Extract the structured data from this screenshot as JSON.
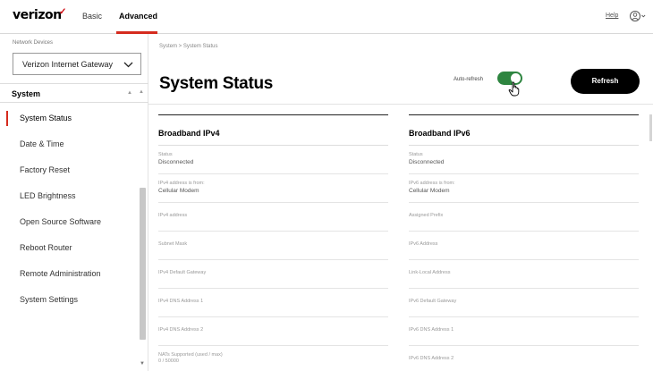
{
  "header": {
    "logo_text": "verizon",
    "logo_mark": "✓",
    "nav_basic": "Basic",
    "nav_advanced": "Advanced",
    "help": "Help",
    "user_icon": "user-circle-icon",
    "accent_color": "#d52b1e"
  },
  "sidebar": {
    "caption": "Network Devices",
    "device_select": "Verizon Internet Gateway",
    "section_title": "System",
    "items": [
      {
        "label": "System Status",
        "active": true
      },
      {
        "label": "Date & Time"
      },
      {
        "label": "Factory Reset"
      },
      {
        "label": "LED Brightness"
      },
      {
        "label": "Open Source Software"
      },
      {
        "label": "Reboot Router"
      },
      {
        "label": "Remote Administration"
      },
      {
        "label": "System Settings"
      }
    ]
  },
  "main": {
    "breadcrumb": "System  >  System Status",
    "title": "System Status",
    "auto_refresh_label": "Auto-refresh",
    "auto_refresh_on": true,
    "toggle_color": "#2e8540",
    "refresh_button": "Refresh",
    "ipv4": {
      "heading": "Broadband IPv4",
      "fields": [
        {
          "label": "Status",
          "value": "Disconnected"
        },
        {
          "label": "IPv4 address is from:",
          "value": "Cellular Modem"
        },
        {
          "label": "IPv4 address",
          "value": ""
        },
        {
          "label": "Subnet Mask",
          "value": ""
        },
        {
          "label": "IPv4 Default Gateway",
          "value": ""
        },
        {
          "label": "IPv4 DNS Address 1",
          "value": ""
        },
        {
          "label": "IPv4 DNS Address 2",
          "value": ""
        },
        {
          "label": "NATs Supported (used / max)",
          "value": "0 / 50000"
        }
      ]
    },
    "ipv6": {
      "heading": "Broadband IPv6",
      "fields": [
        {
          "label": "Status",
          "value": "Disconnected"
        },
        {
          "label": "IPv6 address is from:",
          "value": "Cellular Modem"
        },
        {
          "label": "Assigned Prefix",
          "value": ""
        },
        {
          "label": "IPv6 Address",
          "value": ""
        },
        {
          "label": "Link-Local Address",
          "value": ""
        },
        {
          "label": "IPv6 Default Gateway",
          "value": ""
        },
        {
          "label": "IPv6 DNS Address 1",
          "value": ""
        },
        {
          "label": "IPv6 DNS Address 2",
          "value": ""
        }
      ]
    }
  }
}
